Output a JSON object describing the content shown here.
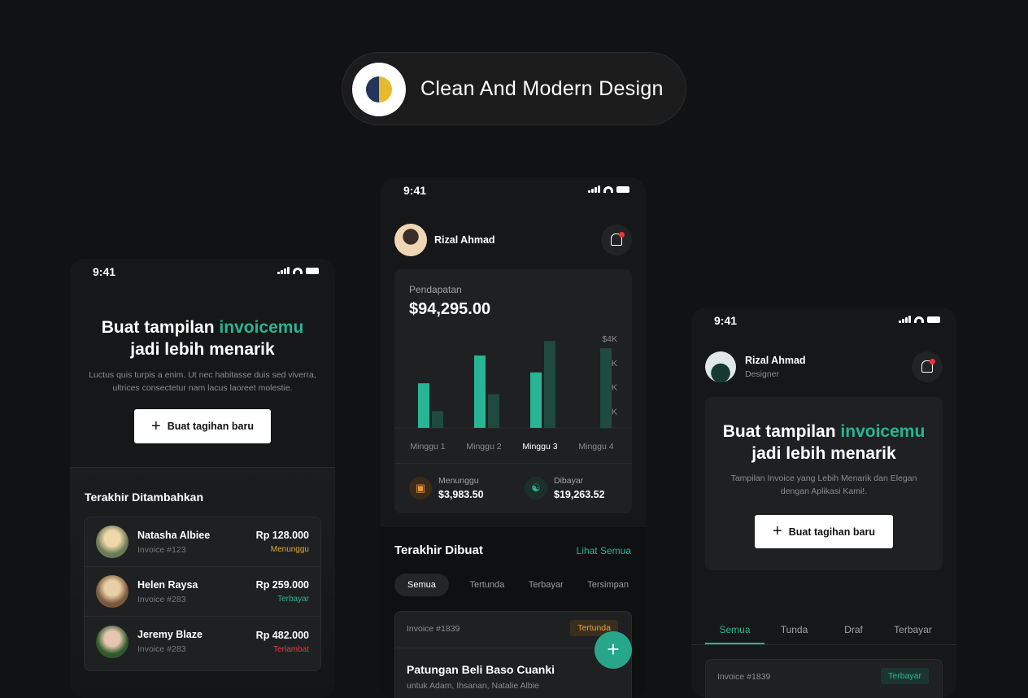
{
  "banner": {
    "title": "Clean And Modern Design",
    "icon": "moon-icon"
  },
  "colors": {
    "accent": "#27b593",
    "pending": "#e8a43b",
    "paid": "#27b593",
    "late": "#e33b4a",
    "background": "#111213"
  },
  "status_bar": {
    "time": "9:41"
  },
  "left_phone": {
    "headline_a": "Buat tampilan ",
    "headline_accent": "invoicemu",
    "headline_b": "jadi lebih menarik",
    "description": "Luctus quis turpis a enim. Ut nec habitasse duis sed viverra, ultrices consectetur nam lacus laoreet molestie.",
    "cta": "Buat tagihan baru",
    "section_title": "Terakhir Ditambahkan",
    "items": [
      {
        "name": "Natasha Albiee",
        "invoice": "Invoice #123",
        "amount": "Rp 128.000",
        "status": "Menunggu",
        "status_color": "#e0a832"
      },
      {
        "name": "Helen Raysa",
        "invoice": "Invoice #283",
        "amount": "Rp 259.000",
        "status": "Terbayar",
        "status_color": "#27b593"
      },
      {
        "name": "Jeremy Blaze",
        "invoice": "Invoice #283",
        "amount": "Rp 482.000",
        "status": "Terlambat",
        "status_color": "#e33b4a"
      }
    ]
  },
  "middle_phone": {
    "user": "Rizal Ahmad",
    "income_label": "Pendapatan",
    "income_value": "$94,295.00",
    "waiting_label": "Menunggu",
    "waiting_value": "$3,983.50",
    "paid_label": "Dibayar",
    "paid_value": "$19,263.52",
    "section_title": "Terakhir Dibuat",
    "see_all": "Lihat Semua",
    "tabs": [
      "Semua",
      "Tertunda",
      "Terbayar",
      "Tersimpan"
    ],
    "active_tab": "Semua",
    "invoice": {
      "number": "Invoice #1839",
      "status": "Tertunda",
      "title": "Patungan Beli Baso Cuanki",
      "subtitle": "untuk Adam, Ihsanan, Natalie Albie"
    }
  },
  "chart_data": {
    "type": "bar",
    "categories": [
      "Minggu 1",
      "Minggu 2",
      "Minggu 3",
      "Minggu 4"
    ],
    "highlighted_category": "Minggu 3",
    "series": [
      {
        "values": [
          2.15,
          3.3,
          2.6,
          0
        ],
        "color": "#27b593"
      },
      {
        "values": [
          1.0,
          1.7,
          3.9,
          3.6
        ],
        "color": "#1e4a3f"
      }
    ],
    "yticks": [
      "$1K",
      "$2K",
      "$3K",
      "$4K"
    ],
    "ylim": [
      0,
      4
    ],
    "yunit": "K$"
  },
  "right_phone": {
    "user": "Rizal Ahmad",
    "role": "Designer",
    "headline_a": "Buat tampilan ",
    "headline_accent": "invoicemu",
    "headline_b": "jadi lebih menarik",
    "description": "Tampilan Invoice yang Lebih Menarik dan Elegan dengan Aplikasi Kami!.",
    "cta": "Buat tagihan baru",
    "tabs": [
      "Semua",
      "Tunda",
      "Draf",
      "Terbayar"
    ],
    "active_tab": "Semua",
    "invoice": {
      "number": "Invoice #1839",
      "status": "Terbayar"
    }
  }
}
